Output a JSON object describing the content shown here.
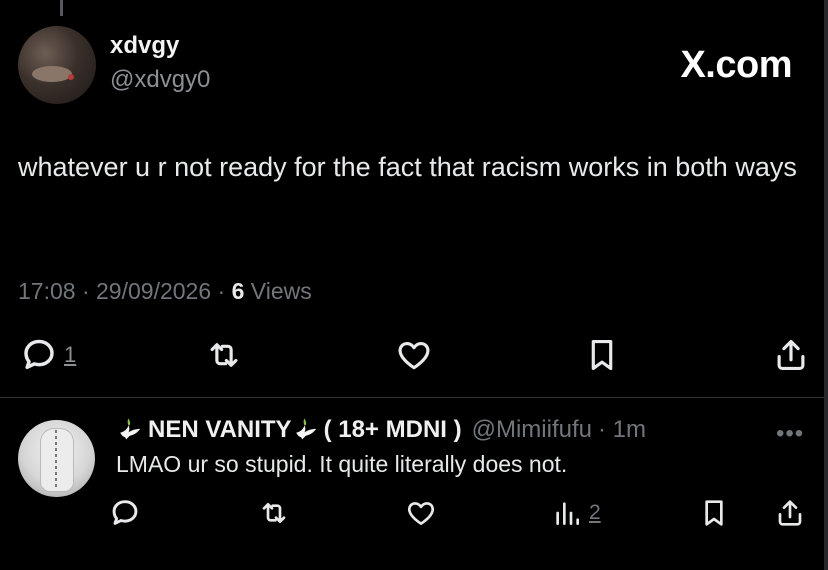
{
  "tweet": {
    "author_name": "xdvgy",
    "author_handle": "@xdvgy0",
    "brand": "X.com",
    "text": "whatever u r not ready for the fact that racism works in both ways",
    "time": "17:08",
    "separator": " · ",
    "date": "29/09/2026",
    "views_count": "6",
    "views_label": " Views",
    "reply_count": "1",
    "icons": [
      "reply-icon",
      "retweet-icon",
      "like-icon",
      "bookmark-icon",
      "share-icon"
    ]
  },
  "reply": {
    "name_prefix": "NEN VANITY",
    "name_suffix": " ( 18+ MDNI )",
    "handle": "@Mimiifufu",
    "time": "· 1m",
    "more": "•••",
    "text": "LMAO ur so stupid. It quite literally does not.",
    "views_count": "2",
    "icons": [
      "reply-icon",
      "retweet-icon",
      "like-icon",
      "views-icon",
      "bookmark-icon",
      "share-icon"
    ]
  },
  "colors": {
    "background": "#000000",
    "text": "#e7e9ea",
    "muted": "#71767b",
    "divider": "#2f3336"
  }
}
